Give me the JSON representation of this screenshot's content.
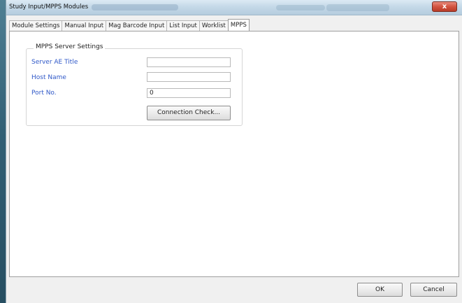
{
  "window": {
    "title": "Study Input/MPPS Modules",
    "close_symbol": "x"
  },
  "tabs": [
    {
      "label": "Module Settings"
    },
    {
      "label": "Manual Input"
    },
    {
      "label": "Mag Barcode Input"
    },
    {
      "label": "List Input"
    },
    {
      "label": "Worklist"
    },
    {
      "label": "MPPS"
    }
  ],
  "mpps_server_settings": {
    "group_title": "MPPS Server Settings",
    "fields": [
      {
        "label": "Server AE Title",
        "value": ""
      },
      {
        "label": "Host Name",
        "value": ""
      },
      {
        "label": "Port No.",
        "value": "0"
      }
    ],
    "connection_check_label": "Connection Check..."
  },
  "buttons": {
    "ok": "OK",
    "cancel": "Cancel"
  },
  "colors": {
    "field_label": "#2f58c8",
    "title_bar": "#c5d9e8",
    "close_button": "#d25440"
  },
  "icons": {
    "close": "close-icon"
  }
}
